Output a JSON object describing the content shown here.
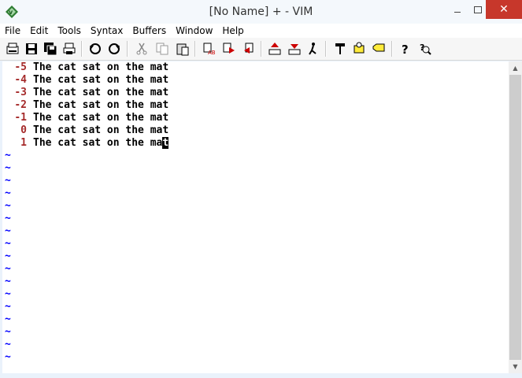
{
  "window": {
    "title": "[No Name] + - VIM",
    "minimize_glyph": "",
    "close_glyph": "✕"
  },
  "menu": [
    "File",
    "Edit",
    "Tools",
    "Syntax",
    "Buffers",
    "Window",
    "Help"
  ],
  "toolbar": {
    "icons": [
      "open-icon",
      "save-icon",
      "save-all-icon",
      "print-icon",
      "undo-icon",
      "redo-icon",
      "cut-icon",
      "copy-icon",
      "paste-icon",
      "replace-icon",
      "find-next-icon",
      "find-prev-icon",
      "load-session-icon",
      "save-session-icon",
      "run-script-icon",
      "make-icon",
      "run-shell-icon",
      "tag-jump-icon",
      "help-icon",
      "find-help-icon"
    ]
  },
  "editor": {
    "lines": [
      {
        "num": "-5",
        "text": "The cat sat on the mat"
      },
      {
        "num": "-4",
        "text": "The cat sat on the mat"
      },
      {
        "num": "-3",
        "text": "The cat sat on the mat"
      },
      {
        "num": "-2",
        "text": "The cat sat on the mat"
      },
      {
        "num": "-1",
        "text": "The cat sat on the mat"
      },
      {
        "num": "0",
        "text": "The cat sat on the mat"
      },
      {
        "num": "1",
        "text_before_cursor": "The cat sat on the ma",
        "cursor_char": "t"
      }
    ],
    "tilde": "~",
    "tilde_count": 17
  },
  "colors": {
    "line_number": "#a52a2a",
    "tilde": "#0000ff",
    "close_button": "#c7372b"
  }
}
